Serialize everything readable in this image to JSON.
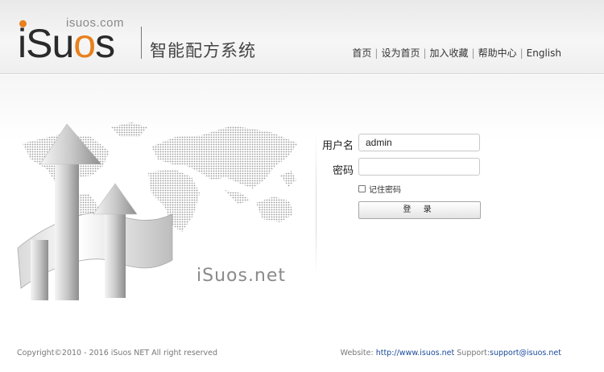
{
  "logo": {
    "domain_text": "isuos.com",
    "wordmark_prefix": "iSu",
    "wordmark_o": "o",
    "wordmark_suffix": "s",
    "accent_color": "#e8801c"
  },
  "header": {
    "system_title": "智能配方系统",
    "nav": [
      "首页",
      "设为首页",
      "加入收藏",
      "帮助中心",
      "English"
    ],
    "separator": "|"
  },
  "login": {
    "username_label": "用户名",
    "username_value": "admin",
    "password_label": "密码",
    "password_value": "",
    "remember_label": "记住密码",
    "remember_checked": false,
    "submit_label": "登 录"
  },
  "illustration": {
    "brand_text": "iSuos.net",
    "icon": "world-map-arrows-illustration"
  },
  "footer": {
    "copyright": "Copyright©2010 - 2016 iSuos NET All right reserved",
    "website_label": "Website: ",
    "website_link": "http://www.isuos.net",
    "support_label": " Support:",
    "support_link": "support@isuos.net"
  }
}
